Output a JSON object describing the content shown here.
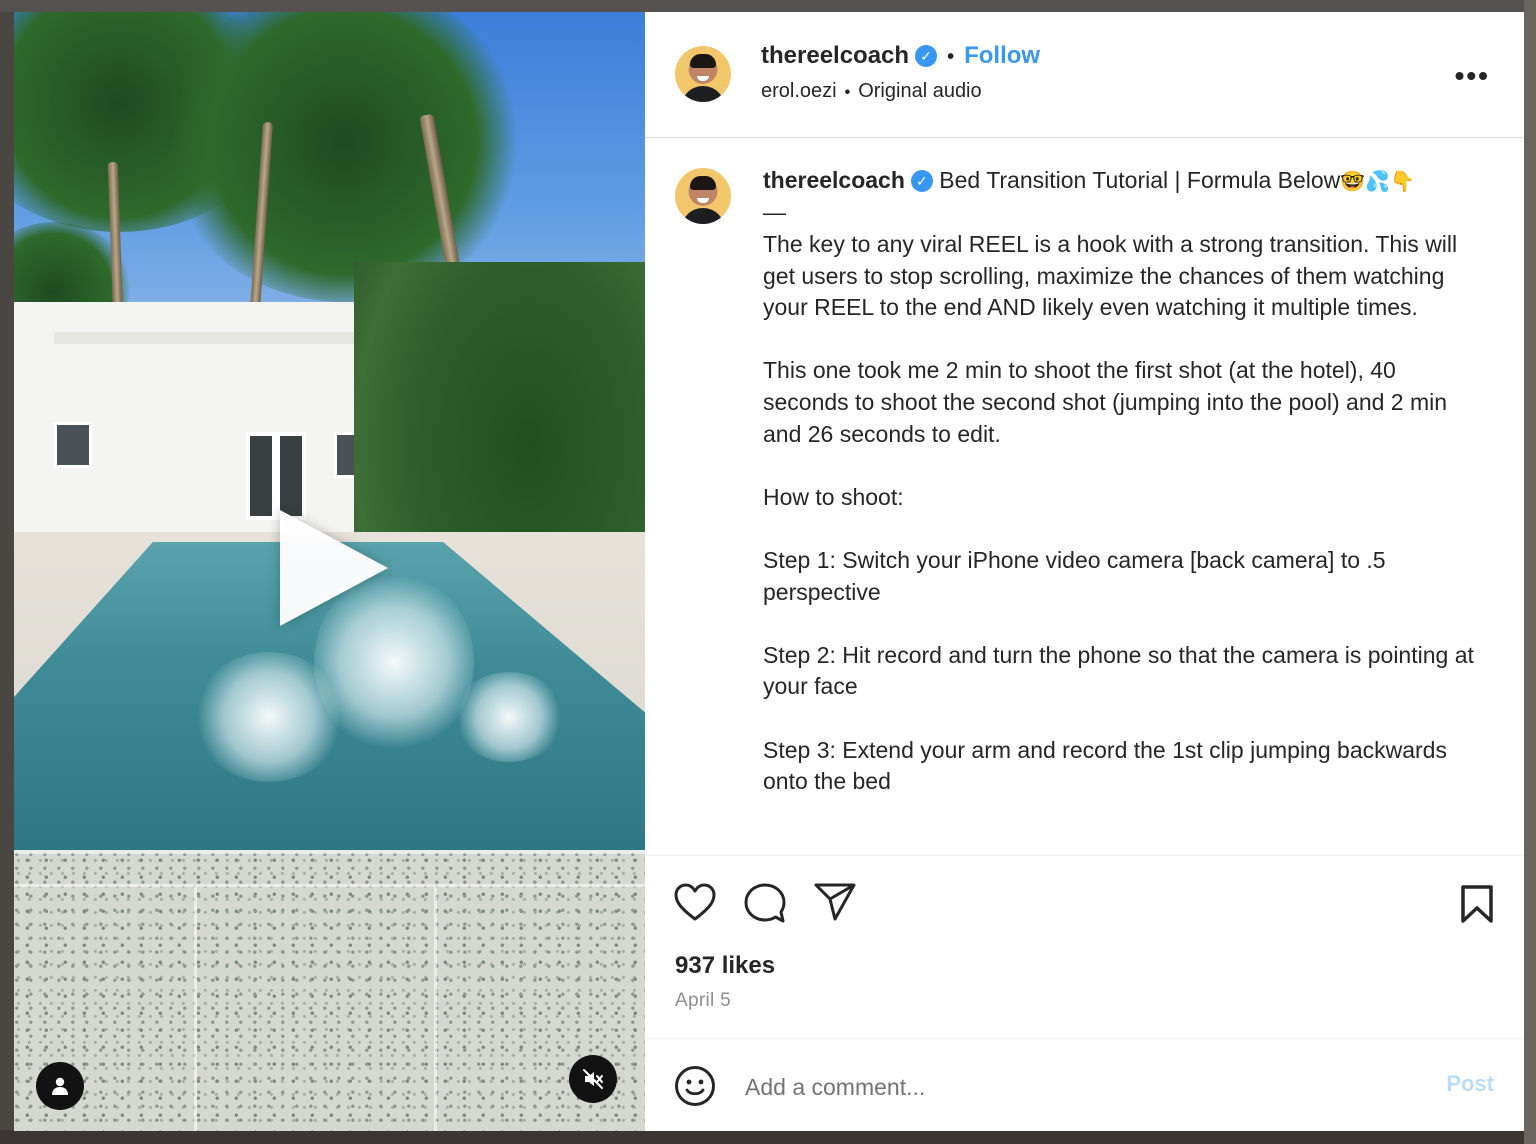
{
  "post": {
    "username": "thereelcoach",
    "verified_mark": "✓",
    "separator": "•",
    "follow_label": "Follow",
    "audio_author": "erol.oezi",
    "audio_name": "Original audio",
    "more_label": "•••"
  },
  "caption": {
    "username": "thereelcoach",
    "title": "Bed Transition Tutorial | Formula Below",
    "title_emoji": "🤓💦👇",
    "dash": "—",
    "paragraphs": [
      "The key to any viral REEL is a hook with a strong transition. This will get users to stop scrolling, maximize the chances of them watching your REEL to the end AND likely even watching it multiple times.",
      "This one took me 2 min to shoot the first shot (at the hotel), 40 seconds to shoot the second shot (jumping into the pool) and 2 min and 26 seconds to edit.",
      "How to shoot:",
      "Step 1: Switch your iPhone video camera [back camera] to .5 perspective",
      "Step 2: Hit record and turn the phone so that the camera is pointing at your face",
      "Step 3: Extend your arm and record the 1st clip jumping backwards onto the bed"
    ]
  },
  "stats": {
    "likes": "937 likes",
    "date": "April 5"
  },
  "comment": {
    "placeholder": "Add a comment...",
    "post_label": "Post"
  },
  "icons": {
    "play": "play-icon",
    "tagged_user": "user-icon",
    "mute": "speaker-muted-icon",
    "like": "heart-icon",
    "comment": "comment-bubble-icon",
    "share": "paper-plane-icon",
    "save": "bookmark-icon",
    "emoji": "smiley-icon"
  },
  "colors": {
    "link_blue": "#3897f0",
    "post_disabled": "#b9dcfb",
    "text": "#262626",
    "muted": "#8e8e8e"
  }
}
